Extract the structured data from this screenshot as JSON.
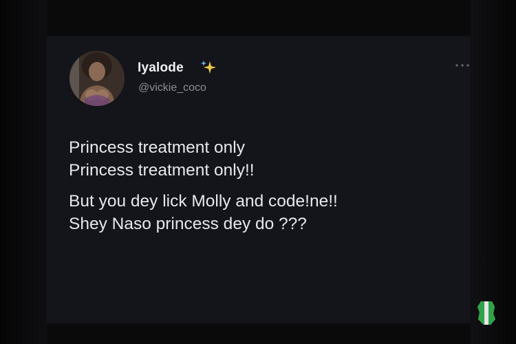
{
  "tweet": {
    "display_name": "Iyalode",
    "handle": "@vickie_coco",
    "text_paragraphs": [
      [
        "Princess treatment only",
        "Princess treatment only!!"
      ],
      [
        "But you dey lick Molly and code!ne!!",
        "Shey Naso princess dey do ???"
      ]
    ]
  },
  "icons": {
    "verified_decoration": "sparkles-icon",
    "menu": "more-horizontal-icon",
    "watermark": "map-logo-icon"
  },
  "colors": {
    "background": "#14151a",
    "text_primary": "#e8e8ec",
    "text_secondary": "#8b8f98",
    "sparkle": "#e8c84a",
    "watermark_green": "#2fa34a"
  }
}
